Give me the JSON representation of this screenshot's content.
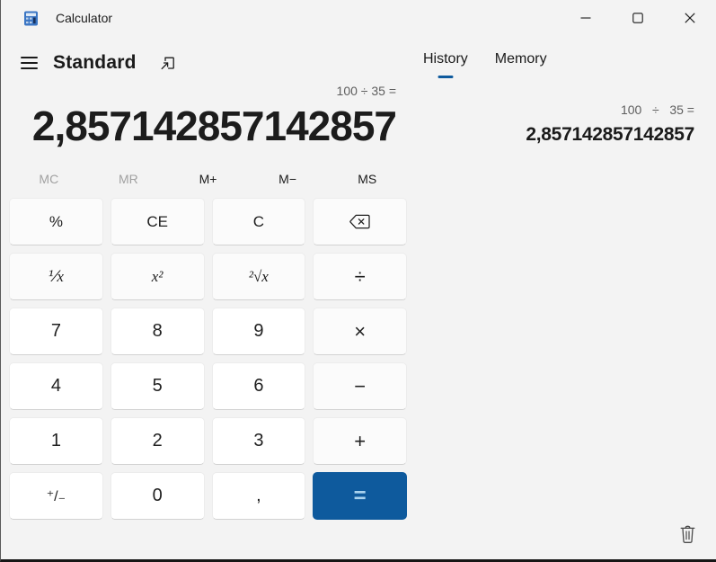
{
  "window": {
    "title": "Calculator",
    "app_icon": "calculator-app-icon",
    "minimize_icon": "minimize-icon",
    "maximize_icon": "maximize-icon",
    "close_icon": "close-icon"
  },
  "header": {
    "menu_icon": "hamburger-icon",
    "mode": "Standard",
    "keep_on_top_icon": "keep-on-top-icon"
  },
  "display": {
    "expression": "100 ÷ 35 =",
    "result": "2,857142857142857"
  },
  "memory": {
    "items": [
      {
        "label": "MC",
        "disabled": true
      },
      {
        "label": "MR",
        "disabled": true
      },
      {
        "label": "M+",
        "disabled": false
      },
      {
        "label": "M−",
        "disabled": false
      },
      {
        "label": "MS",
        "disabled": false
      }
    ]
  },
  "keypad": {
    "keys": [
      {
        "label": "%",
        "type": "func"
      },
      {
        "label": "CE",
        "type": "func"
      },
      {
        "label": "C",
        "type": "func"
      },
      {
        "label": "⌫",
        "icon": "backspace-icon",
        "type": "func"
      },
      {
        "label": "⅟x",
        "type": "func-math"
      },
      {
        "label": "x²",
        "type": "func-math"
      },
      {
        "label": "²√x",
        "type": "func-math"
      },
      {
        "label": "÷",
        "type": "op"
      },
      {
        "label": "7",
        "type": "num"
      },
      {
        "label": "8",
        "type": "num"
      },
      {
        "label": "9",
        "type": "num"
      },
      {
        "label": "×",
        "type": "op"
      },
      {
        "label": "4",
        "type": "num"
      },
      {
        "label": "5",
        "type": "num"
      },
      {
        "label": "6",
        "type": "num"
      },
      {
        "label": "−",
        "type": "op"
      },
      {
        "label": "1",
        "type": "num"
      },
      {
        "label": "2",
        "type": "num"
      },
      {
        "label": "3",
        "type": "num"
      },
      {
        "label": "+",
        "type": "op"
      },
      {
        "label": "⁺/₋",
        "type": "num"
      },
      {
        "label": "0",
        "type": "num"
      },
      {
        "label": ",",
        "type": "num"
      },
      {
        "label": "=",
        "type": "equals"
      }
    ]
  },
  "history_panel": {
    "tabs": [
      {
        "label": "History",
        "active": true
      },
      {
        "label": "Memory",
        "active": false
      }
    ],
    "entries": [
      {
        "expression": "100   ÷   35 =",
        "result": "2,857142857142857"
      }
    ],
    "clear_icon": "trash-icon"
  },
  "colors": {
    "background": "#f3f3f3",
    "accent": "#0e5a9d",
    "equals_glyph": "#a9d3ef",
    "disabled_text": "#a1a1a1",
    "expression_text": "#5e5e5e"
  }
}
